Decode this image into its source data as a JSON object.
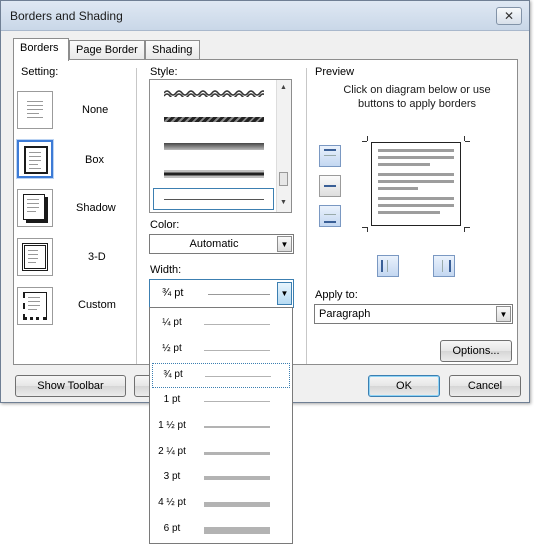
{
  "window": {
    "title": "Borders and Shading",
    "close_glyph": "✕"
  },
  "tabs": [
    {
      "label": "Borders",
      "active": true
    },
    {
      "label": "Page Border",
      "active": false
    },
    {
      "label": "Shading",
      "active": false
    }
  ],
  "setting": {
    "label": "Setting:",
    "items": [
      {
        "label": "None",
        "icon": "setting-none-icon"
      },
      {
        "label": "Box",
        "icon": "setting-box-icon",
        "selected": true
      },
      {
        "label": "Shadow",
        "icon": "setting-shadow-icon"
      },
      {
        "label": "3-D",
        "icon": "setting-3d-icon"
      },
      {
        "label": "Custom",
        "icon": "setting-custom-icon"
      }
    ]
  },
  "style": {
    "label": "Style:"
  },
  "color": {
    "label": "Color:",
    "value": "Automatic"
  },
  "width": {
    "label": "Width:",
    "value": "¾ pt"
  },
  "width_options": [
    {
      "label": "¼ pt",
      "thickness": 1
    },
    {
      "label": "½ pt",
      "thickness": 1
    },
    {
      "label": "¾ pt",
      "thickness": 1,
      "selected": true
    },
    {
      "label": "1 pt",
      "thickness": 1
    },
    {
      "label": "1 ½ pt",
      "thickness": 2
    },
    {
      "label": "2 ¼ pt",
      "thickness": 3
    },
    {
      "label": "3 pt",
      "thickness": 4
    },
    {
      "label": "4 ½ pt",
      "thickness": 5
    },
    {
      "label": "6 pt",
      "thickness": 7
    }
  ],
  "preview": {
    "label": "Preview",
    "instructions": "Click on diagram below or use buttons to apply borders"
  },
  "apply_to": {
    "label": "Apply to:",
    "value": "Paragraph"
  },
  "buttons": {
    "options": "Options...",
    "show_toolbar": "Show Toolbar",
    "ok": "OK",
    "cancel": "Cancel"
  },
  "colors": {
    "accent": "#3c7fb1",
    "selection_border": "#3d7bd6"
  }
}
